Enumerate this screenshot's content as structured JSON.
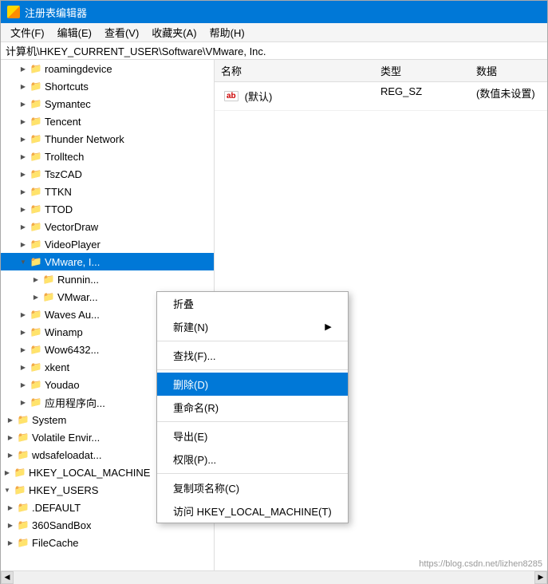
{
  "window": {
    "title": "注册表编辑器"
  },
  "menu": {
    "items": [
      {
        "label": "文件(F)"
      },
      {
        "label": "编辑(E)"
      },
      {
        "label": "查看(V)"
      },
      {
        "label": "收藏夹(A)"
      },
      {
        "label": "帮助(H)"
      }
    ]
  },
  "breadcrumb": "计算机\\HKEY_CURRENT_USER\\Software\\VMware, Inc.",
  "tree": {
    "items": [
      {
        "id": "roamingdevice",
        "label": "roamingdevice",
        "indent": 2,
        "state": "collapsed"
      },
      {
        "id": "shortcuts",
        "label": "Shortcuts",
        "indent": 2,
        "state": "collapsed"
      },
      {
        "id": "symantec",
        "label": "Symantec",
        "indent": 2,
        "state": "collapsed"
      },
      {
        "id": "tencent",
        "label": "Tencent",
        "indent": 2,
        "state": "collapsed"
      },
      {
        "id": "thunder",
        "label": "Thunder Network",
        "indent": 2,
        "state": "collapsed"
      },
      {
        "id": "trolltech",
        "label": "Trolltech",
        "indent": 2,
        "state": "collapsed"
      },
      {
        "id": "tszcad",
        "label": "TszCAD",
        "indent": 2,
        "state": "collapsed"
      },
      {
        "id": "ttkn",
        "label": "TTKN",
        "indent": 2,
        "state": "collapsed"
      },
      {
        "id": "ttod",
        "label": "TTOD",
        "indent": 2,
        "state": "collapsed"
      },
      {
        "id": "vectordraw",
        "label": "VectorDraw",
        "indent": 2,
        "state": "collapsed"
      },
      {
        "id": "videoplayer",
        "label": "VideoPlayer",
        "indent": 2,
        "state": "collapsed"
      },
      {
        "id": "vmware",
        "label": "VMware, I...",
        "indent": 2,
        "state": "expanded",
        "selected": true
      },
      {
        "id": "running",
        "label": "Runnin...",
        "indent": 3,
        "state": "collapsed"
      },
      {
        "id": "vmware2",
        "label": "VMwar...",
        "indent": 3,
        "state": "collapsed"
      },
      {
        "id": "wavesaudio",
        "label": "Waves Au...",
        "indent": 2,
        "state": "collapsed"
      },
      {
        "id": "winamp",
        "label": "Winamp",
        "indent": 2,
        "state": "collapsed"
      },
      {
        "id": "wow6432",
        "label": "Wow6432...",
        "indent": 2,
        "state": "collapsed"
      },
      {
        "id": "xkent",
        "label": "xkent",
        "indent": 2,
        "state": "collapsed"
      },
      {
        "id": "youdao",
        "label": "Youdao",
        "indent": 2,
        "state": "collapsed"
      },
      {
        "id": "appdir",
        "label": "应用程序向...",
        "indent": 2,
        "state": "collapsed"
      },
      {
        "id": "system",
        "label": "System",
        "indent": 1,
        "state": "collapsed"
      },
      {
        "id": "volatile",
        "label": "Volatile Envir...",
        "indent": 1,
        "state": "collapsed"
      },
      {
        "id": "wdsafe",
        "label": "wdsafeloadat...",
        "indent": 1,
        "state": "collapsed"
      },
      {
        "id": "hklm",
        "label": "HKEY_LOCAL_MACHINE",
        "indent": 0,
        "state": "collapsed"
      },
      {
        "id": "hku",
        "label": "HKEY_USERS",
        "indent": 0,
        "state": "expanded"
      },
      {
        "id": "default",
        "label": ".DEFAULT",
        "indent": 1,
        "state": "collapsed"
      },
      {
        "id": "sandbox",
        "label": "360SandBox",
        "indent": 1,
        "state": "collapsed"
      },
      {
        "id": "filecache",
        "label": "FileCache",
        "indent": 1,
        "state": "collapsed"
      }
    ]
  },
  "right_panel": {
    "headers": [
      "名称",
      "类型",
      "数据"
    ],
    "rows": [
      {
        "name": "(默认)",
        "type": "REG_SZ",
        "data": "(数值未设置)",
        "has_ab": true
      }
    ]
  },
  "context_menu": {
    "items": [
      {
        "id": "collapse",
        "label": "折叠",
        "separator_after": false
      },
      {
        "id": "new",
        "label": "新建(N)",
        "has_arrow": true,
        "separator_after": true
      },
      {
        "id": "find",
        "label": "查找(F)...",
        "separator_after": true
      },
      {
        "id": "delete",
        "label": "删除(D)",
        "highlighted": true,
        "separator_after": false
      },
      {
        "id": "rename",
        "label": "重命名(R)",
        "separator_after": true
      },
      {
        "id": "export",
        "label": "导出(E)",
        "separator_after": false
      },
      {
        "id": "permissions",
        "label": "权限(P)...",
        "separator_after": true
      },
      {
        "id": "copy_name",
        "label": "复制项名称(C)",
        "separator_after": false
      },
      {
        "id": "access_hklm",
        "label": "访问 HKEY_LOCAL_MACHINE(T)",
        "separator_after": false
      }
    ]
  },
  "watermark": "https://blog.csdn.net/lizhen8285"
}
